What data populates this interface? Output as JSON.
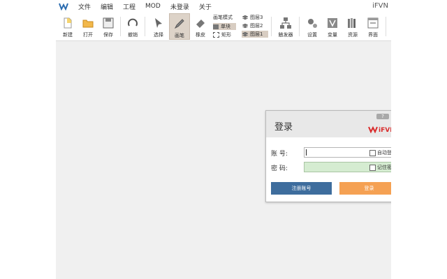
{
  "app": {
    "title": "iFVN"
  },
  "menu": {
    "items": [
      "文件",
      "编辑",
      "工程",
      "MOD",
      "未登录",
      "关于"
    ]
  },
  "toolbar": {
    "new": "新建",
    "open": "打开",
    "save": "保存",
    "undo": "撤销",
    "select": "选择",
    "pen": "画笔",
    "eraser": "橡皮",
    "pen_mode": {
      "title": "画笔模式",
      "block": "单块",
      "rect": "矩形"
    },
    "layers": [
      "图层3",
      "图层2",
      "图层1"
    ],
    "trigger": "触发器",
    "settings": "设置",
    "variables": "变量",
    "resources": "资源",
    "interface": "界面"
  },
  "login": {
    "title": "登录",
    "help": "?",
    "brand": "iFVN",
    "account_label": "账 号:",
    "password_label": "密 码:",
    "auto_login": "自动登",
    "remember_password": "记住密",
    "register_button": "注册账号",
    "login_button": "登录"
  },
  "colors": {
    "register": "#3e6d9d",
    "login": "#f5a153",
    "password_field": "#d5ecd1",
    "selected_tool": "#ddd3c8",
    "canvas": "#f0f0f0"
  }
}
